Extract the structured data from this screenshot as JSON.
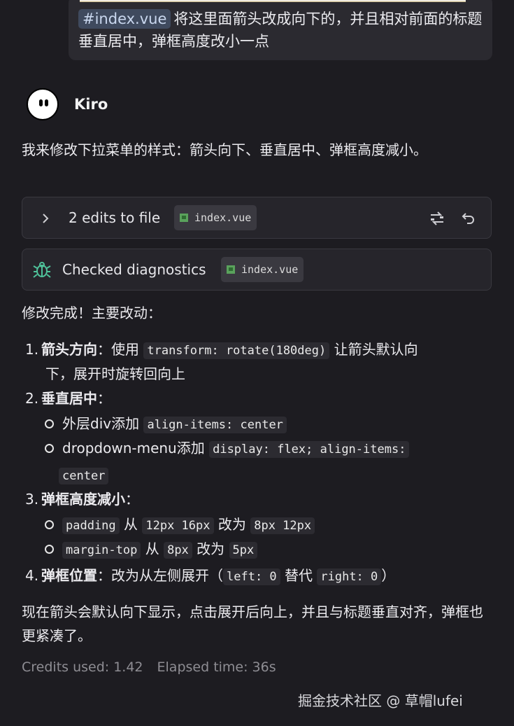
{
  "user_message": {
    "file_chip": "#index.vue",
    "text": "将这里面箭头改成向下的，并且相对前面的标题垂直居中，弹框高度改小一点"
  },
  "agent": {
    "name": "Kiro"
  },
  "intro": "我来修改下拉菜单的样式：箭头向下、垂直居中、弹框高度减小。",
  "edits_card": {
    "label": "2 edits to file",
    "file": "index.vue"
  },
  "diag_card": {
    "label": "Checked diagnostics",
    "file": "index.vue"
  },
  "done_title": "修改完成！主要改动：",
  "list": {
    "i1_num": "1.",
    "i1_title": "箭头方向",
    "i1_pre": "：使用",
    "i1_code": "transform: rotate(180deg)",
    "i1_post": "让箭头默认向",
    "i1_line2": "下，展开时旋转回向上",
    "i2_num": "2.",
    "i2_title": "垂直居中",
    "i2_colon": "：",
    "s1_pre": "外层div添加",
    "s1_code": "align-items: center",
    "s2_pre": "dropdown-menu添加",
    "s2_code_a": "display: flex; align-items:",
    "s2_code_b": "center",
    "i3_num": "3.",
    "i3_title": "弹框高度减小",
    "i3_colon": "：",
    "s3_code1": "padding",
    "s3_from": "从",
    "s3_code2": "12px 16px",
    "s3_to": "改为",
    "s3_code3": "8px 12px",
    "s4_code1": "margin-top",
    "s4_from": "从",
    "s4_code2": "8px",
    "s4_to": "改为",
    "s4_code3": "5px",
    "i4_num": "4.",
    "i4_title": "弹框位置",
    "i4_pre": "：改为从左侧展开（",
    "i4_code1": "left: 0",
    "i4_mid": "替代",
    "i4_code2": "right: 0",
    "i4_post": "）"
  },
  "summary": "现在箭头会默认向下显示，点击展开后向上，并且与标题垂直对齐，弹框也更紧凑了。",
  "meta": {
    "credits": "Credits used: 1.42",
    "elapsed": "Elapsed time: 36s"
  },
  "watermark": "掘金技术社区 @ 草帽lufei",
  "icons": [
    "chevron-right-icon",
    "vue-file-icon",
    "compare-icon",
    "undo-icon",
    "bug-icon"
  ]
}
